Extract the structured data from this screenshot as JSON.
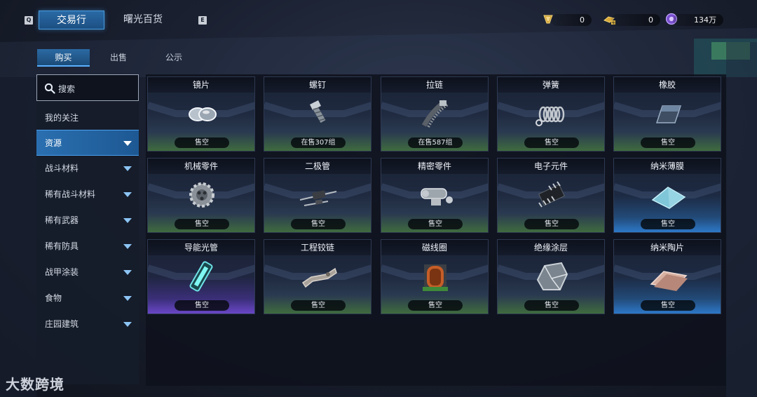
{
  "topbar": {
    "left_key": "Q",
    "right_key": "E",
    "tabs": [
      {
        "label": "交易行",
        "active": true
      },
      {
        "label": "曙光百货",
        "active": false
      }
    ],
    "currencies": [
      {
        "icon": "gold-shard-icon",
        "value": "0"
      },
      {
        "icon": "gold-ingot-plus-icon",
        "value": "0"
      },
      {
        "icon": "purple-coin-icon",
        "value": "134万"
      }
    ]
  },
  "subtabs": [
    {
      "label": "购买",
      "active": true
    },
    {
      "label": "出售",
      "active": false
    },
    {
      "label": "公示",
      "active": false
    }
  ],
  "sidebar": {
    "search_placeholder": "搜索",
    "items": [
      {
        "label": "我的关注",
        "has_caret": false,
        "active": false
      },
      {
        "label": "资源",
        "has_caret": true,
        "active": true
      },
      {
        "label": "战斗材料",
        "has_caret": true,
        "active": false
      },
      {
        "label": "稀有战斗材料",
        "has_caret": true,
        "active": false
      },
      {
        "label": "稀有武器",
        "has_caret": true,
        "active": false
      },
      {
        "label": "稀有防具",
        "has_caret": true,
        "active": false
      },
      {
        "label": "战甲涂装",
        "has_caret": true,
        "active": false
      },
      {
        "label": "食物",
        "has_caret": true,
        "active": false
      },
      {
        "label": "庄园建筑",
        "has_caret": true,
        "active": false
      }
    ]
  },
  "items": [
    {
      "name": "镜片",
      "status": "售空",
      "rarity": "green",
      "icon": "lens-icon"
    },
    {
      "name": "螺钉",
      "status": "在售307组",
      "rarity": "green",
      "icon": "screw-icon"
    },
    {
      "name": "拉链",
      "status": "在售587组",
      "rarity": "green",
      "icon": "zipper-icon"
    },
    {
      "name": "弹簧",
      "status": "售空",
      "rarity": "green",
      "icon": "spring-icon"
    },
    {
      "name": "橡胶",
      "status": "售空",
      "rarity": "green",
      "icon": "rubber-icon"
    },
    {
      "name": "机械零件",
      "status": "售空",
      "rarity": "green",
      "icon": "gear-icon"
    },
    {
      "name": "二极管",
      "status": "售空",
      "rarity": "green",
      "icon": "diode-icon"
    },
    {
      "name": "精密零件",
      "status": "售空",
      "rarity": "green",
      "icon": "precision-part-icon"
    },
    {
      "name": "电子元件",
      "status": "售空",
      "rarity": "green",
      "icon": "chip-icon"
    },
    {
      "name": "纳米薄膜",
      "status": "售空",
      "rarity": "blue",
      "icon": "film-icon"
    },
    {
      "name": "导能光管",
      "status": "售空",
      "rarity": "purple",
      "icon": "light-tube-icon"
    },
    {
      "name": "工程铰链",
      "status": "售空",
      "rarity": "green",
      "icon": "hinge-icon"
    },
    {
      "name": "磁线圈",
      "status": "售空",
      "rarity": "green",
      "icon": "coil-icon"
    },
    {
      "name": "绝缘涂层",
      "status": "售空",
      "rarity": "green",
      "icon": "insulation-icon"
    },
    {
      "name": "纳米陶片",
      "status": "售空",
      "rarity": "blue",
      "icon": "ceramic-icon"
    }
  ],
  "watermark": "大数跨境"
}
